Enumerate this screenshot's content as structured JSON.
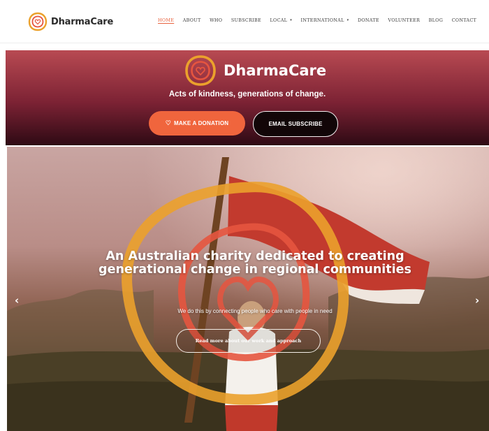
{
  "brand": {
    "name": "DharmaCare",
    "trademark": ""
  },
  "nav": {
    "items": [
      {
        "label": "HOME",
        "active": true,
        "dropdown": false
      },
      {
        "label": "ABOUT",
        "active": false,
        "dropdown": false
      },
      {
        "label": "WHO",
        "active": false,
        "dropdown": false
      },
      {
        "label": "SUBSCRIBE",
        "active": false,
        "dropdown": false
      },
      {
        "label": "LOCAL",
        "active": false,
        "dropdown": true
      },
      {
        "label": "INTERNATIONAL",
        "active": false,
        "dropdown": true
      },
      {
        "label": "DONATE",
        "active": false,
        "dropdown": false
      },
      {
        "label": "VOLUNTEER",
        "active": false,
        "dropdown": false
      },
      {
        "label": "BLOG",
        "active": false,
        "dropdown": false
      },
      {
        "label": "CONTACT",
        "active": false,
        "dropdown": false
      }
    ],
    "dropdown_icon": "▾"
  },
  "hero_band": {
    "logo_text": "DharmaCare",
    "tagline": "Acts of kindness, generations of change.",
    "donate_button": "MAKE A DONATION",
    "donate_icon": "♡",
    "subscribe_button": "EMAIL SUBSCRIBE"
  },
  "slider": {
    "headline": "An Australian charity dedicated to creating generational change in regional communities",
    "subline": "We do this by connecting people who care with people in need",
    "read_more_button": "Read more about our work and approach",
    "prev_arrow": "‹",
    "next_arrow": "›"
  },
  "colors": {
    "accent": "#e8633f",
    "donate": "#f0653d",
    "band_top": "#b84a52",
    "band_bottom": "#2e0a14",
    "logo_outer": "#eba12c",
    "logo_inner": "#e6553f"
  },
  "icons": [
    "dharmacare-logo-icon",
    "heart-icon",
    "chevron-left-icon",
    "chevron-right-icon",
    "chevron-down-icon"
  ]
}
